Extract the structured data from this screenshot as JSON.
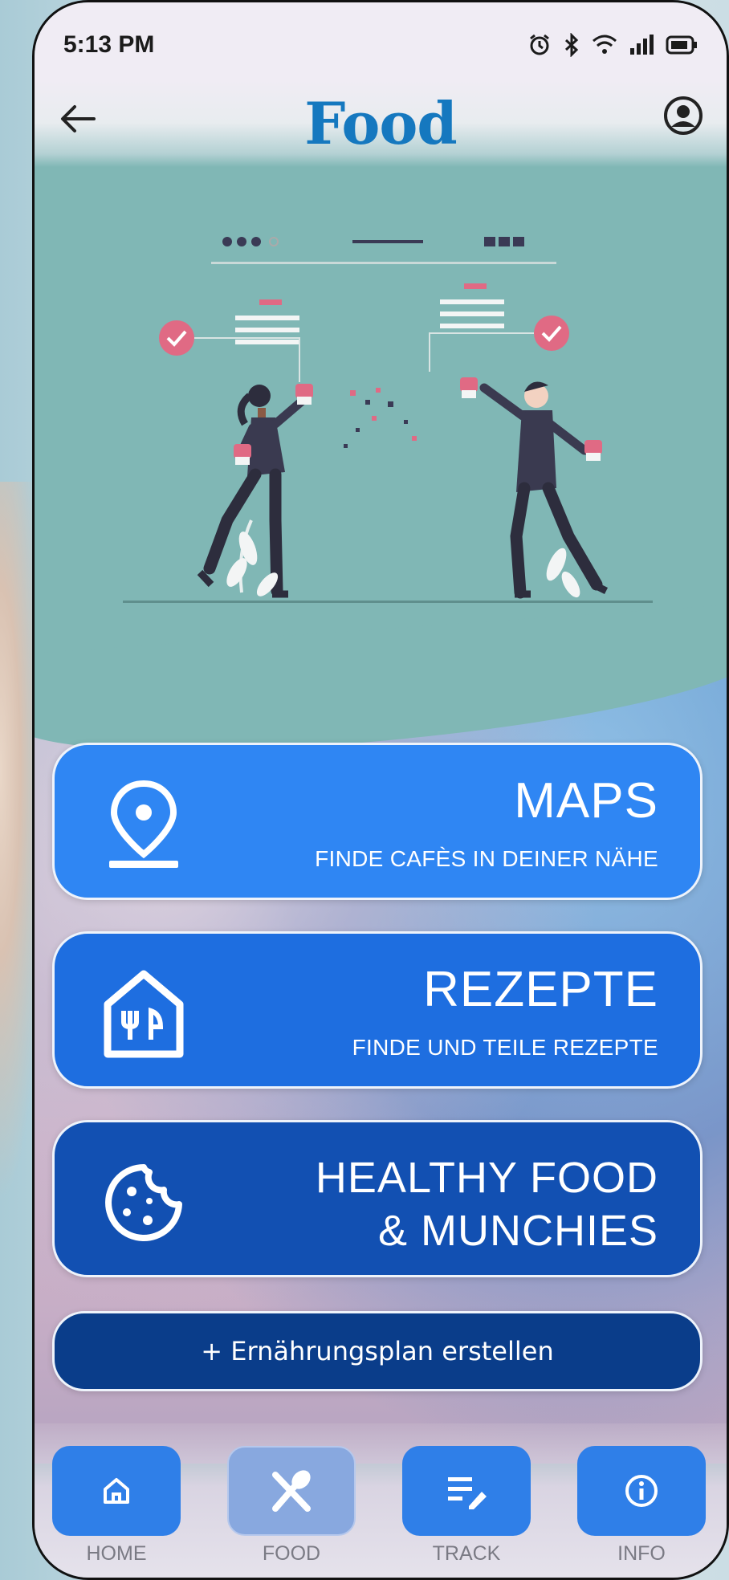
{
  "status_bar": {
    "time": "5:13 PM",
    "icons": [
      "alarm-icon",
      "bluetooth-icon",
      "wifi-icon",
      "signal-icon",
      "battery-icon"
    ]
  },
  "header": {
    "title": "Food",
    "back_icon": "arrow-left-icon",
    "profile_icon": "user-circle-icon",
    "title_color": "#1578bf"
  },
  "hero": {
    "illustration": "two-people-with-cupcakes-illustration"
  },
  "cards": {
    "maps": {
      "title": "MAPS",
      "subtitle": "FINDE CAFÈS IN DEINER NÄHE",
      "icon": "map-pin-icon",
      "color": "#2f86f3"
    },
    "rezepte": {
      "title": "REZEPTE",
      "subtitle": "FINDE UND TEILE REZEPTE",
      "icon": "restaurant-house-icon",
      "color": "#1e6ee0"
    },
    "healthy": {
      "title_line1": "HEALTHY FOOD",
      "title_line2": "& MUNCHIES",
      "icon": "cookie-icon",
      "color": "#1250b2"
    },
    "plan": {
      "label": "+ Ernährungsplan erstellen",
      "color": "#0a3d8a"
    }
  },
  "bottom_nav": {
    "items": [
      {
        "label": "HOME",
        "icon": "home-icon",
        "active": false
      },
      {
        "label": "FOOD",
        "icon": "fork-spoon-icon",
        "active": true
      },
      {
        "label": "TRACK",
        "icon": "list-edit-icon",
        "active": false
      },
      {
        "label": "INFO",
        "icon": "info-icon",
        "active": false
      }
    ]
  }
}
